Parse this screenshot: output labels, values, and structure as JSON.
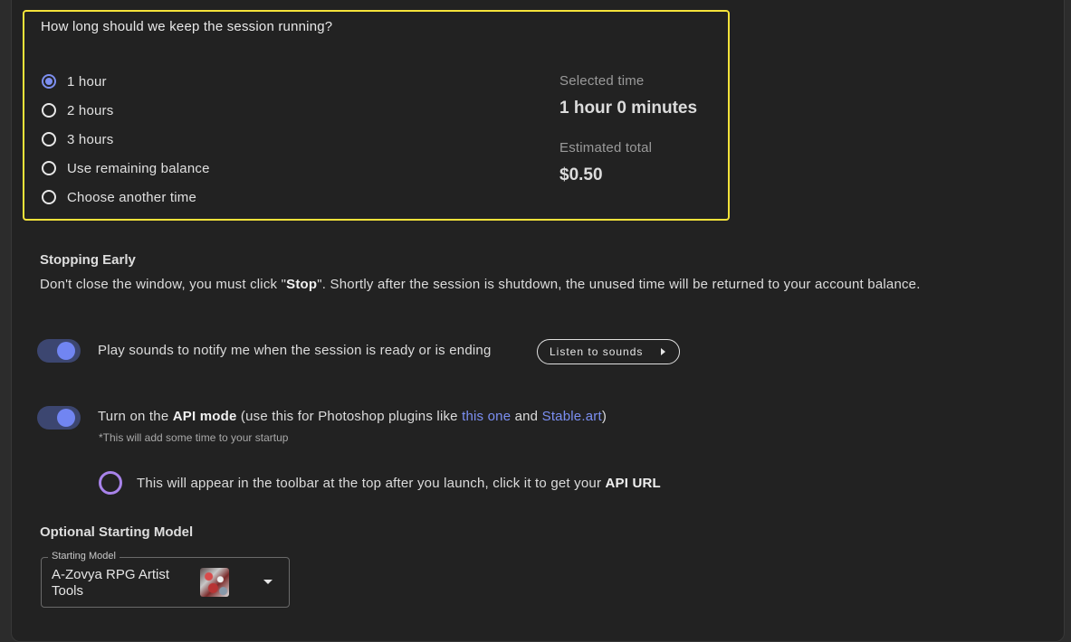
{
  "duration": {
    "question": "How long should we keep the session running?",
    "options": [
      {
        "label": "1 hour",
        "selected": true
      },
      {
        "label": "2 hours",
        "selected": false
      },
      {
        "label": "3 hours",
        "selected": false
      },
      {
        "label": "Use remaining balance",
        "selected": false
      },
      {
        "label": "Choose another time",
        "selected": false
      }
    ],
    "selected_time_label": "Selected time",
    "selected_time_value": "1 hour 0 minutes",
    "estimated_total_label": "Estimated total",
    "estimated_total_value": "$0.50"
  },
  "stopping_early": {
    "title": "Stopping Early",
    "text_before": "Don't close the window, you must click \"",
    "text_bold": "Stop",
    "text_after": "\". Shortly after the session is shutdown, the unused time will be returned to your account balance."
  },
  "sounds": {
    "toggle_on": true,
    "label": "Play sounds to notify me when the session is ready or is ending",
    "button_label": "Listen to sounds",
    "button_icon": "play-arrow-icon"
  },
  "api_mode": {
    "toggle_on": true,
    "text_prefix": "Turn on the ",
    "text_bold": "API mode",
    "text_middle": " (use this for Photoshop plugins like ",
    "link1": "this one",
    "text_and": " and ",
    "link2": "Stable.art",
    "text_suffix": ")",
    "note": "*This will add some time to your startup",
    "info_icon": "ring-icon",
    "info_text": "This will appear in the toolbar at the top after you launch, click it to get your ",
    "info_bold": "API URL"
  },
  "starting_model": {
    "title": "Optional Starting Model",
    "field_label": "Starting Model",
    "value": "A-Zovya RPG Artist Tools",
    "dropdown_icon": "chevron-down-icon"
  },
  "colors": {
    "highlight_border": "#f5e33a",
    "accent": "#7d8ff0",
    "link": "#7b8ff2",
    "ring": "#a883ea"
  }
}
